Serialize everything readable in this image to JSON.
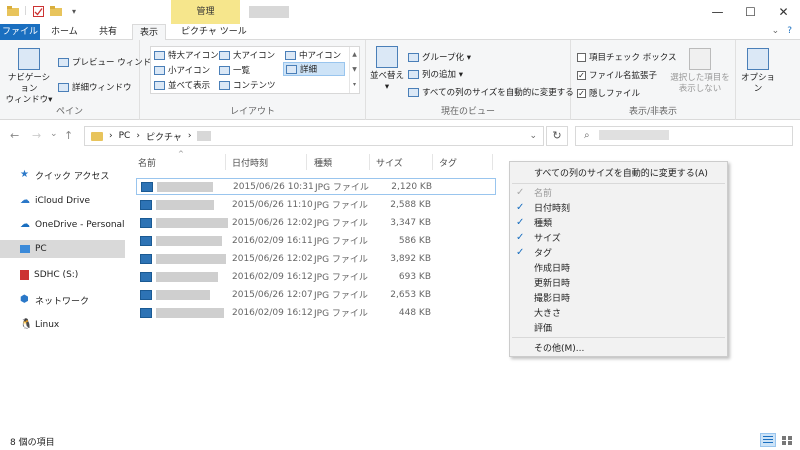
{
  "titlebar": {
    "contextual_tab_header": "管理",
    "minimize": "—",
    "maximize": "☐",
    "close": "✕"
  },
  "tabs": {
    "file": "ファイル",
    "home": "ホーム",
    "share": "共有",
    "view": "表示",
    "picture_tools": "ピクチャ ツール"
  },
  "ribbon": {
    "pane": {
      "nav_pane": "ナビゲーション",
      "nav_pane_line2": "ウィンドウ▾",
      "preview": "プレビュー ウィンドウ",
      "details_pane": "詳細ウィンドウ",
      "label": "ペイン"
    },
    "layout": {
      "extra_large": "特大アイコン",
      "large": "大アイコン",
      "medium": "中アイコン",
      "small": "小アイコン",
      "list": "一覧",
      "details": "詳細",
      "tiles": "並べて表示",
      "content": "コンテンツ",
      "label": "レイアウト"
    },
    "current_view": {
      "sort": "並べ替え",
      "group": "グループ化 ▾",
      "add_columns": "列の追加 ▾",
      "autosize": "すべての列のサイズを自動的に変更する",
      "label": "現在のビュー"
    },
    "show_hide": {
      "item_checkboxes": "項目チェック ボックス",
      "extensions": "ファイル名拡張子",
      "hidden": "隠しファイル",
      "hide_selected_1": "選択した項目を",
      "hide_selected_2": "表示しない",
      "label": "表示/非表示"
    },
    "options": "オプション"
  },
  "address": {
    "back": "←",
    "forward": "→",
    "recent": "⌄",
    "up": "↑",
    "path_pc": "PC",
    "path_pictures": "ピクチャ",
    "refresh": "↻",
    "search_icon": "⌕"
  },
  "navpane": {
    "items": [
      "クイック アクセス",
      "iCloud Drive",
      "OneDrive - Personal",
      "PC",
      "SDHC (S:)",
      "ネットワーク",
      "Linux"
    ]
  },
  "columns": {
    "name": "名前",
    "date": "日付時刻",
    "type": "種類",
    "size": "サイズ",
    "tag": "タグ"
  },
  "files": [
    {
      "date": "2015/06/26 10:31",
      "type": "JPG ファイル",
      "size": "2,120 KB"
    },
    {
      "date": "2015/06/26 11:10",
      "type": "JPG ファイル",
      "size": "2,588 KB"
    },
    {
      "date": "2015/06/26 12:02",
      "type": "JPG ファイル",
      "size": "3,347 KB"
    },
    {
      "date": "2016/02/09 16:11",
      "type": "JPG ファイル",
      "size": "586 KB"
    },
    {
      "date": "2015/06/26 12:02",
      "type": "JPG ファイル",
      "size": "3,892 KB"
    },
    {
      "date": "2016/02/09 16:12",
      "type": "JPG ファイル",
      "size": "693 KB"
    },
    {
      "date": "2015/06/26 12:07",
      "type": "JPG ファイル",
      "size": "2,653 KB"
    },
    {
      "date": "2016/02/09 16:12",
      "type": "JPG ファイル",
      "size": "448 KB"
    }
  ],
  "menu": {
    "autosize": "すべての列のサイズを自動的に変更する(A)",
    "items": [
      {
        "label": "名前",
        "checked": true,
        "disabled": true
      },
      {
        "label": "日付時刻",
        "checked": true
      },
      {
        "label": "種類",
        "checked": true
      },
      {
        "label": "サイズ",
        "checked": true
      },
      {
        "label": "タグ",
        "checked": true
      },
      {
        "label": "作成日時",
        "checked": false
      },
      {
        "label": "更新日時",
        "checked": false
      },
      {
        "label": "撮影日時",
        "checked": false
      },
      {
        "label": "大きさ",
        "checked": false
      },
      {
        "label": "評価",
        "checked": false
      }
    ],
    "more": "その他(M)..."
  },
  "status": {
    "count": "8 個の項目"
  },
  "colors": {
    "accent": "#1a6fc0",
    "context_tab": "#f6e68c",
    "selection": "#cde3f7"
  }
}
